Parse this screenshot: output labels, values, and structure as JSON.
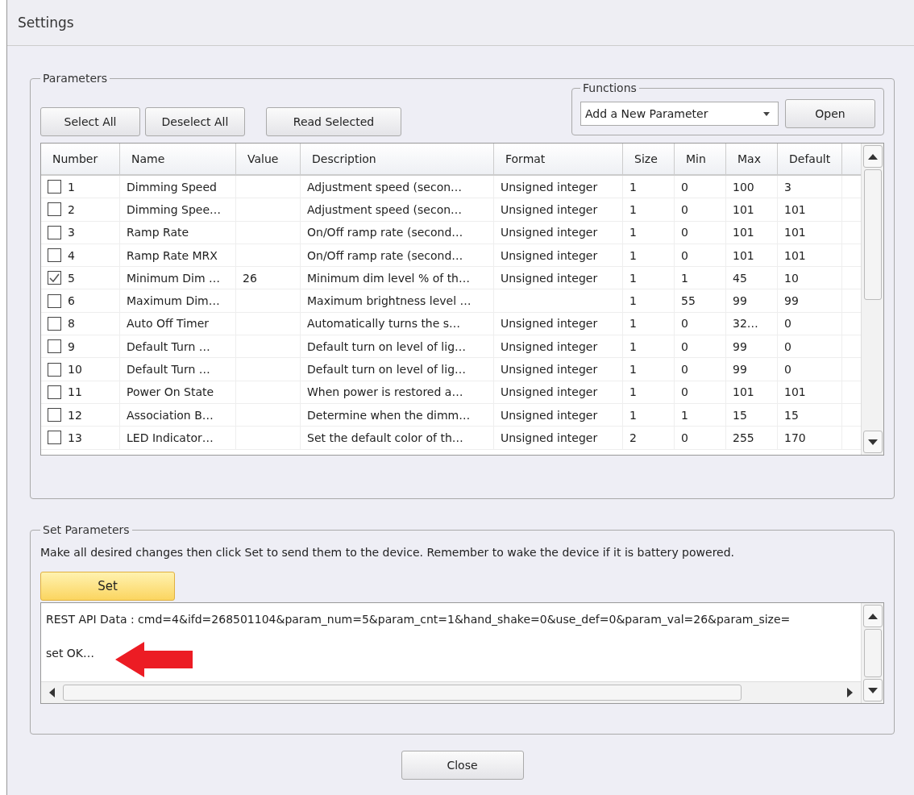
{
  "window": {
    "title": "Settings"
  },
  "parameters": {
    "title": "Parameters",
    "buttons": [
      "Select All",
      "Deselect All",
      "Read Selected"
    ],
    "functions": {
      "title": "Functions",
      "dropdown": "Add a New Parameter",
      "button": "Open"
    }
  },
  "table": {
    "columns": [
      "Number",
      "Name",
      "Value",
      "Description",
      "Format",
      "Size",
      "Min",
      "Max",
      "Default"
    ],
    "rows": [
      {
        "checked": false,
        "number": "1",
        "name": "Dimming Speed",
        "description": "Adjustment speed (secon…",
        "format": "Unsigned integer",
        "size": "1",
        "min": "0",
        "max": "100",
        "default": "3"
      },
      {
        "checked": false,
        "number": "2",
        "name": "Dimming Spee…",
        "description": "Adjustment speed (secon…",
        "format": "Unsigned integer",
        "size": "1",
        "min": "0",
        "max": "101",
        "default": "101"
      },
      {
        "checked": false,
        "number": "3",
        "name": "Ramp Rate",
        "description": "On/Off ramp rate (second…",
        "format": "Unsigned integer",
        "size": "1",
        "min": "0",
        "max": "101",
        "default": "101"
      },
      {
        "checked": false,
        "number": "4",
        "name": "Ramp Rate MRX",
        "description": "On/Off ramp rate (second…",
        "format": "Unsigned integer",
        "size": "1",
        "min": "0",
        "max": "101",
        "default": "101"
      },
      {
        "checked": true,
        "number": "5",
        "name": "Minimum Dim …",
        "value": "26",
        "description": "Minimum dim level % of th…",
        "format": "Unsigned integer",
        "size": "1",
        "min": "1",
        "max": "45",
        "default": "10"
      },
      {
        "checked": false,
        "number": "6",
        "name": "Maximum Dim…",
        "description": "Maximum brightness level …",
        "size": "1",
        "min": "55",
        "max": "99",
        "default": "99"
      },
      {
        "checked": false,
        "number": "8",
        "name": "Auto Off Timer",
        "description": "Automatically turns the s…",
        "format": "Unsigned integer",
        "size": "1",
        "min": "0",
        "max": "32…",
        "default": "0"
      },
      {
        "checked": false,
        "number": "9",
        "name": "Default Turn …",
        "description": "Default turn on level of lig…",
        "format": "Unsigned integer",
        "size": "1",
        "min": "0",
        "max": "99",
        "default": "0"
      },
      {
        "checked": false,
        "number": "10",
        "name": "Default Turn …",
        "description": "Default turn on level of lig…",
        "format": "Unsigned integer",
        "size": "1",
        "min": "0",
        "max": "99",
        "default": "0"
      },
      {
        "checked": false,
        "number": "11",
        "name": "Power On State",
        "description": "When power is restored a…",
        "format": "Unsigned integer",
        "size": "1",
        "min": "0",
        "max": "101",
        "default": "101"
      },
      {
        "checked": false,
        "number": "12",
        "name": "Association B…",
        "description": "Determine when the dimm…",
        "format": "Unsigned integer",
        "size": "1",
        "min": "1",
        "max": "15",
        "default": "15"
      },
      {
        "checked": false,
        "number": "13",
        "name": "LED Indicator…",
        "description": "Set the default color of th…",
        "format": "Unsigned integer",
        "size": "2",
        "min": "0",
        "max": "255",
        "default": "170"
      }
    ]
  },
  "set_parameters": {
    "title": "Set Parameters",
    "instructions": "Make all desired changes then click Set to send them to the device. Remember to wake the device if it is battery powered.",
    "set_button": "Set",
    "log": [
      "REST API Data : cmd=4&ifd=268501104&param_num=5&param_cnt=1&hand_shake=0&use_def=0&param_val=26&param_size=",
      "set OK…"
    ]
  },
  "close_button": "Close"
}
